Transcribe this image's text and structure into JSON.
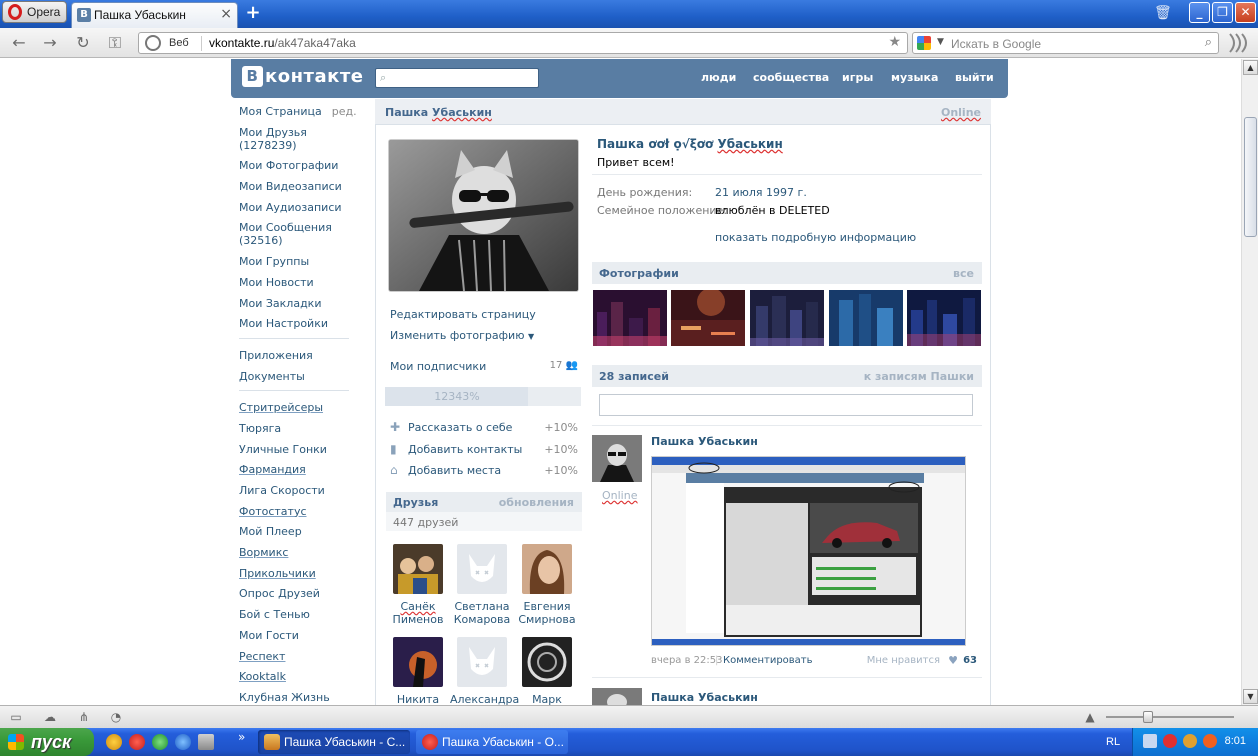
{
  "opera": {
    "menu_label": "Opera",
    "tab_title": "Пашка Убаськин",
    "tab_close": "×",
    "new_tab": "+",
    "address": {
      "web_label": "Веб",
      "host": "vkontakte.ru",
      "path": "/ak47aka47aka"
    },
    "search_placeholder": "Искать в Google"
  },
  "vk": {
    "logo_letter": "В",
    "logo_text": "контакте",
    "nav": [
      "люди",
      "сообщества",
      "игры",
      "музыка",
      "выйти"
    ]
  },
  "left_menu": {
    "group1": [
      {
        "label": "Моя Страница",
        "extra": "ред."
      },
      {
        "label": "Мои Друзья (1278239)"
      },
      {
        "label": "Мои Фотографии"
      },
      {
        "label": "Мои Видеозаписи"
      },
      {
        "label": "Мои Аудиозаписи"
      },
      {
        "label": "Мои Сообщения (32516)"
      },
      {
        "label": "Мои Группы"
      },
      {
        "label": "Мои Новости"
      },
      {
        "label": "Мои Закладки"
      },
      {
        "label": "Мои Настройки"
      }
    ],
    "group2": [
      {
        "label": "Приложения"
      },
      {
        "label": "Документы"
      }
    ],
    "group3": [
      {
        "label": "Стритрейсеры",
        "underline": true
      },
      {
        "label": "Тюряга",
        "underline": true
      },
      {
        "label": "Уличные Гонки"
      },
      {
        "label": "Фармандия",
        "underline": true
      },
      {
        "label": "Лига Скорости"
      },
      {
        "label": "Фотостатус",
        "underline": true
      },
      {
        "label": "Мой Плеер"
      },
      {
        "label": "Вормикс",
        "underline": true
      },
      {
        "label": "Прикольчики",
        "underline": true
      },
      {
        "label": "Опрос Друзей"
      },
      {
        "label": "Бой с Тенью"
      },
      {
        "label": "Мои Гости"
      },
      {
        "label": "Респект",
        "underline": true
      },
      {
        "label": "Kooktalk",
        "underline": true
      },
      {
        "label": "Клубная Жизнь"
      }
    ]
  },
  "profile": {
    "header_name_first": "Пашка",
    "header_name_last": "Убаськин",
    "header_status": "Online",
    "edit_page": "Редактировать страницу",
    "change_photo": "Изменить фотографию",
    "subscribers_label": "Мои подписчики",
    "subscribers_count": "17",
    "completion_text": "12343%",
    "completion_level": 0.73,
    "bonuses": [
      {
        "label": "Рассказать о себе",
        "percent": "+10%",
        "icon": "plus-icon"
      },
      {
        "label": "Добавить контакты",
        "percent": "+10%",
        "icon": "phone-icon"
      },
      {
        "label": "Добавить места",
        "percent": "+10%",
        "icon": "house-icon"
      }
    ],
    "friends_title": "Друзья",
    "friends_updates": "обновления",
    "friends_count": "447 друзей",
    "friends": [
      {
        "first": "Санёк",
        "last": "Пименов",
        "underline": true
      },
      {
        "first": "Светлана",
        "last": "Комарова"
      },
      {
        "first": "Евгения",
        "last": "Смирнова"
      },
      {
        "first": "Никита",
        "last": ""
      },
      {
        "first": "Александра",
        "last": ""
      },
      {
        "first": "Марк",
        "last": ""
      }
    ],
    "full_name_first": "Пашка",
    "full_name_middle": "ơơł ọ√ξơơ",
    "full_name_last": "Убаськин",
    "status": "Привет всем!",
    "info": [
      {
        "key": "День рождения:",
        "value": "21 июля 1997 г.",
        "link": true
      },
      {
        "key": "Семейное положение:",
        "value": "влюблён в DELETED",
        "link": false
      }
    ],
    "more_info": "показать подробную информацию",
    "photos_title": "Фотографии",
    "photos_all": "все",
    "wall_count": "28 записей",
    "wall_link": "к записям Пашки",
    "post": {
      "author": "Пашка Убаськин",
      "online": "Online",
      "date": "вчера в 22:53",
      "sep": "|",
      "comment": "Комментировать",
      "like_label": "Мне нравится",
      "likes": "63"
    },
    "post2_author": "Пашка Убаськин"
  },
  "taskbar": {
    "start": "пуск",
    "items": [
      "Пашка Убаськин - С...",
      "Пашка Убаськин - О..."
    ],
    "more": "»",
    "lang": "RL",
    "clock": "8:01"
  },
  "colors": {
    "vk_blue": "#597da3",
    "link": "#2b587a",
    "xp_blue": "#245edb",
    "xp_green": "#3a9a3a"
  }
}
